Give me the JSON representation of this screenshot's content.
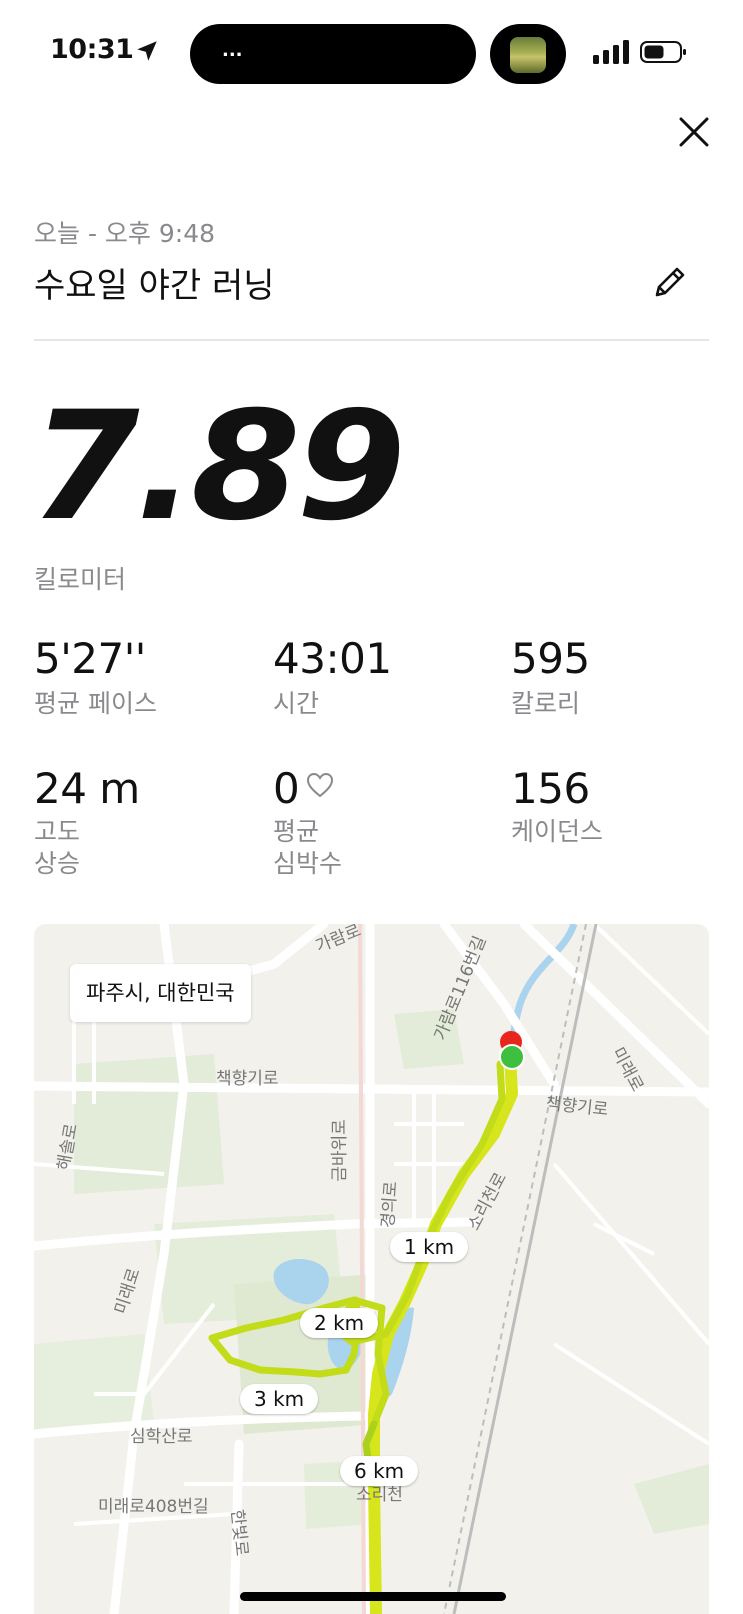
{
  "status_bar": {
    "time": "10:31",
    "island_text": "...",
    "icons": [
      "location-arrow-icon",
      "signal-bars-icon",
      "battery-icon"
    ]
  },
  "header": {
    "date": "오늘 - 오후 9:48",
    "title": "수요일 야간 러닝",
    "close_icon": "close-icon",
    "edit_icon": "pencil-icon"
  },
  "summary": {
    "distance": "7.89",
    "distance_unit": "킬로미터"
  },
  "stats": [
    {
      "value": "5'27''",
      "label": "평균 페이스"
    },
    {
      "value": "43:01",
      "label": "시간"
    },
    {
      "value": "595",
      "label": "칼로리"
    },
    {
      "value": "24 m",
      "label_line1": "고도",
      "label_line2": "상승"
    },
    {
      "value": "0",
      "label_line1": "평균",
      "label_line2": "심박수",
      "icon": "heart-icon"
    },
    {
      "value": "156",
      "label": "케이던스"
    }
  ],
  "map": {
    "location": "파주시, 대한민국",
    "km_markers": [
      "1 km",
      "2 km",
      "3 km",
      "6 km"
    ],
    "road_labels": [
      "가람로",
      "가람로116번길",
      "책향기로",
      "책향기로",
      "미래로",
      "해솔로",
      "금바위로",
      "경의로",
      "소리천로",
      "미래로",
      "심학산로",
      "미래로408번길",
      "한빛로",
      "소리천"
    ],
    "start_color": "#3fbf3f",
    "end_color": "#e8261e",
    "route_color": "#c9de1f"
  }
}
